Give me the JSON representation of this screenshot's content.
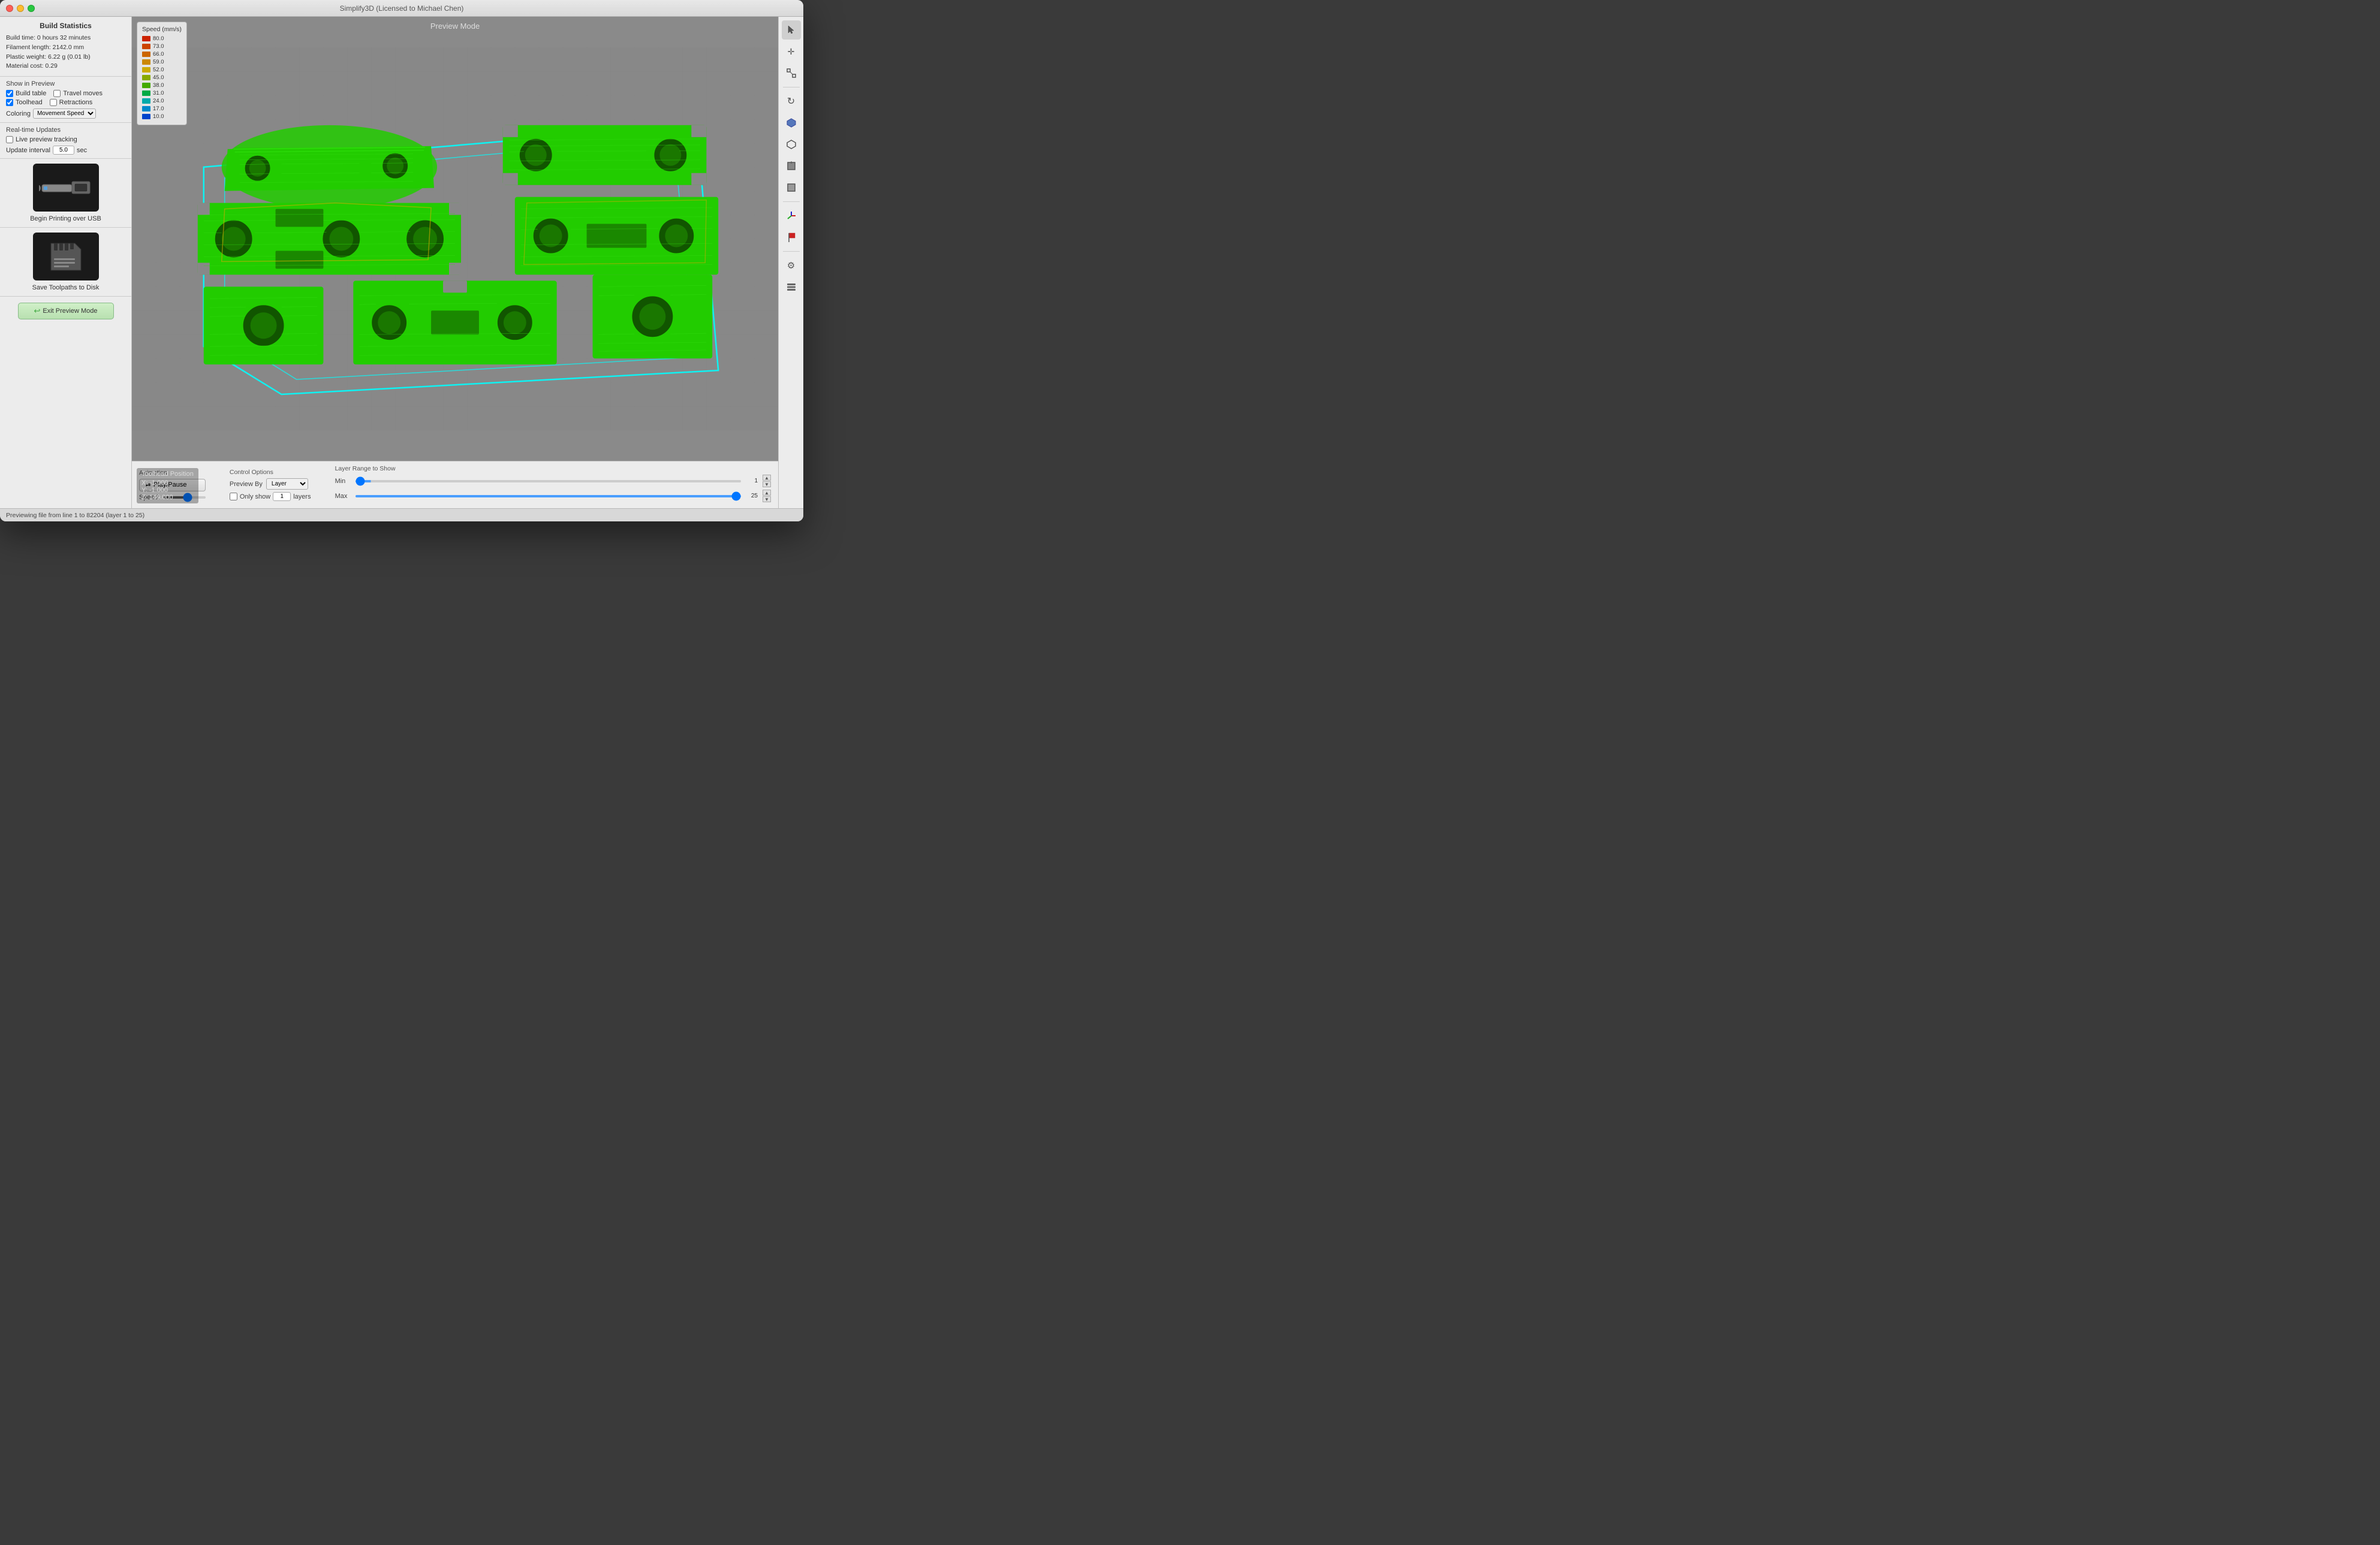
{
  "window": {
    "title": "Simplify3D (Licensed to Michael Chen)"
  },
  "build_stats": {
    "title": "Build Statistics",
    "build_time": "Build time: 0 hours 32 minutes",
    "filament_length": "Filament length: 2142.0 mm",
    "plastic_weight": "Plastic weight: 6.22 g (0.01 lb)",
    "material_cost": "Material cost: 0.29"
  },
  "show_in_preview": {
    "title": "Show in Preview",
    "build_table": {
      "label": "Build table",
      "checked": true
    },
    "travel_moves": {
      "label": "Travel moves",
      "checked": false
    },
    "toolhead": {
      "label": "Toolhead",
      "checked": true
    },
    "retractions": {
      "label": "Retractions",
      "checked": false
    },
    "coloring_label": "Coloring",
    "coloring_value": "Movement Speed"
  },
  "realtime_updates": {
    "title": "Real-time Updates",
    "live_tracking_label": "Live preview tracking",
    "live_tracking_checked": false,
    "update_interval_label": "Update interval",
    "update_interval_value": "5.0",
    "sec_label": "sec"
  },
  "usb_section": {
    "label": "Begin Printing over USB"
  },
  "sd_section": {
    "label": "Save Toolpaths to Disk"
  },
  "exit_preview": {
    "label": "Exit Preview Mode"
  },
  "viewport": {
    "mode_label": "Preview Mode"
  },
  "speed_legend": {
    "title": "Speed (mm/s)",
    "items": [
      {
        "value": "80.0",
        "color": "#cc2200"
      },
      {
        "value": "73.0",
        "color": "#cc4400"
      },
      {
        "value": "66.0",
        "color": "#cc6600"
      },
      {
        "value": "59.0",
        "color": "#cc8800"
      },
      {
        "value": "52.0",
        "color": "#ccaa00"
      },
      {
        "value": "45.0",
        "color": "#88aa00"
      },
      {
        "value": "38.0",
        "color": "#44aa00"
      },
      {
        "value": "31.0",
        "color": "#00aa44"
      },
      {
        "value": "24.0",
        "color": "#00aaaa"
      },
      {
        "value": "17.0",
        "color": "#0088cc"
      },
      {
        "value": "10.0",
        "color": "#0044cc"
      }
    ]
  },
  "toolhead_position": {
    "title": "Toolhead Position",
    "x": "X: -1.000",
    "y": "Y: -1.000",
    "z": "Z: 149.000"
  },
  "animation": {
    "title": "Animation",
    "play_pause_label": "Play/Pause",
    "speed_label": "Speed:"
  },
  "control_options": {
    "title": "Control Options",
    "preview_by_label": "Preview By",
    "preview_by_value": "Layer",
    "only_show_label": "Only show",
    "only_show_value": "1",
    "layers_label": "layers"
  },
  "layer_range": {
    "title": "Layer Range to Show",
    "min_label": "Min",
    "min_value": "1",
    "max_label": "Max",
    "max_value": "25"
  },
  "status_bar": {
    "text": "Previewing file from line 1 to 82204 (layer 1 to 25)"
  },
  "right_toolbar": {
    "buttons": [
      {
        "name": "cursor-icon",
        "icon": "⬆",
        "active": true
      },
      {
        "name": "move-icon",
        "icon": "✛"
      },
      {
        "name": "scale-icon",
        "icon": "⤢"
      },
      {
        "name": "rotate-icon",
        "icon": "↻"
      },
      {
        "name": "shield-solid-icon",
        "icon": "⬟"
      },
      {
        "name": "shield-outline-icon",
        "icon": "⬡"
      },
      {
        "name": "cube-icon",
        "icon": "⬡"
      },
      {
        "name": "shield2-icon",
        "icon": "⬟"
      },
      {
        "name": "axes-icon",
        "icon": "⊕"
      },
      {
        "name": "flag-icon",
        "icon": "⚑"
      },
      {
        "name": "gear-icon",
        "icon": "⚙"
      },
      {
        "name": "list-icon",
        "icon": "☰"
      }
    ]
  }
}
